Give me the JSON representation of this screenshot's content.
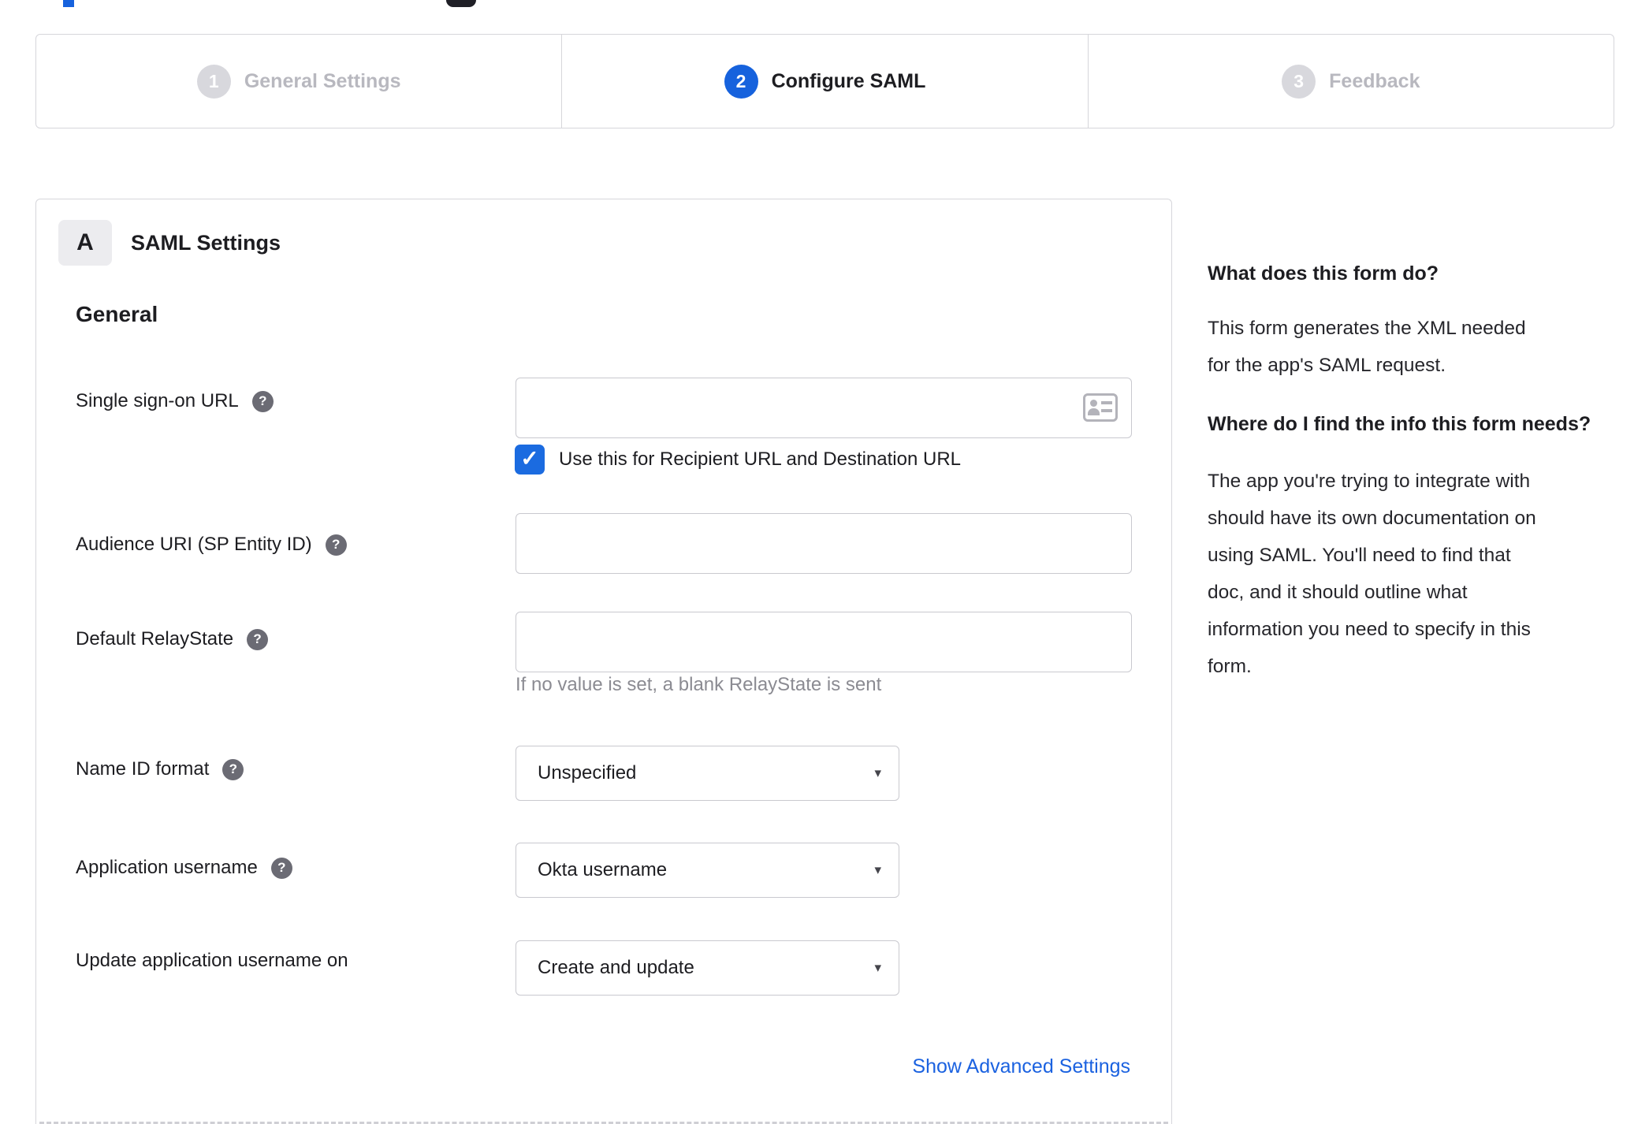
{
  "colors": {
    "accent": "#1662dd",
    "link": "#1b62e0",
    "checkbox": "#1b6be0"
  },
  "stepper": {
    "steps": [
      {
        "number": "1",
        "label": "General Settings",
        "state": "inactive"
      },
      {
        "number": "2",
        "label": "Configure SAML",
        "state": "active"
      },
      {
        "number": "3",
        "label": "Feedback",
        "state": "inactive"
      }
    ]
  },
  "panel": {
    "badge": "A",
    "title": "SAML Settings",
    "section_heading": "General",
    "sso": {
      "label": "Single sign-on URL",
      "value": "",
      "checkbox_label": "Use this for Recipient URL and Destination URL",
      "checkbox_checked": true
    },
    "audience": {
      "label": "Audience URI (SP Entity ID)",
      "value": ""
    },
    "relay": {
      "label": "Default RelayState",
      "value": "",
      "helper": "If no value is set, a blank RelayState is sent"
    },
    "name_id": {
      "label": "Name ID format",
      "value": "Unspecified"
    },
    "app_username": {
      "label": "Application username",
      "value": "Okta username"
    },
    "update_username": {
      "label": "Update application username on",
      "value": "Create and update"
    },
    "advanced_link": "Show Advanced Settings"
  },
  "icons": {
    "help_glyph": "?",
    "dropdown_arrow_glyph": "▾",
    "check_glyph": "✓"
  },
  "sidebar": {
    "q1": "What does this form do?",
    "a1_lines": [
      "This form generates the XML needed",
      "for the app's SAML request."
    ],
    "q2_lines": [
      "Where do I find the info this form",
      "needs?"
    ],
    "a2_lines": [
      "The app you're trying to integrate with",
      "should have its own documentation on",
      "using SAML. You'll need to find that",
      "doc, and it should outline what",
      "information you need to specify in this",
      "form."
    ]
  }
}
